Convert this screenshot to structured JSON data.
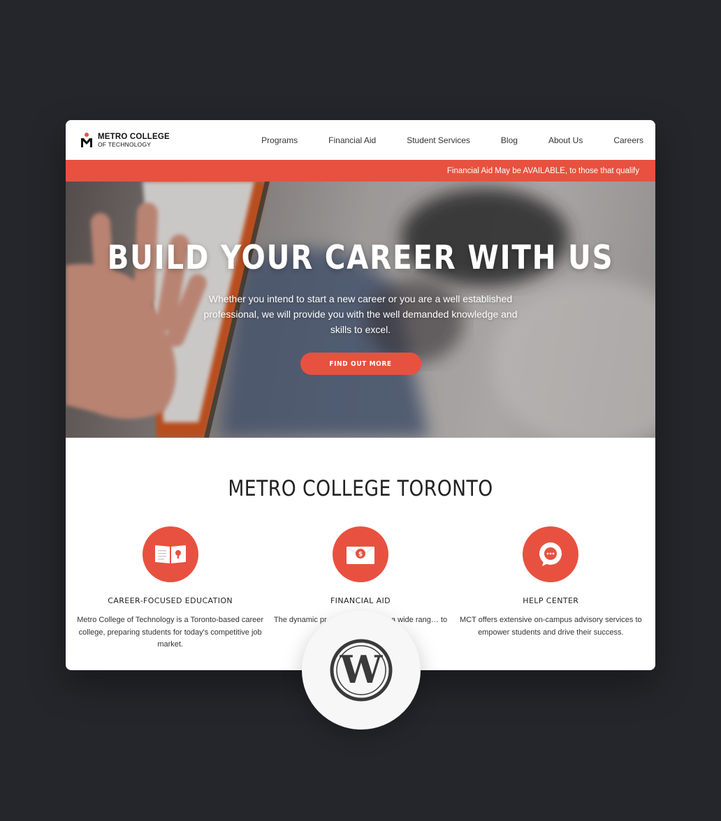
{
  "brand": {
    "line1": "METRO COLLEGE",
    "line2": "OF TECHNOLOGY",
    "logo_icon": "metro-person-icon",
    "accent": "#e8513f",
    "dark_bg": "#24262b"
  },
  "nav": {
    "items": [
      {
        "label": "Programs"
      },
      {
        "label": "Financial Aid"
      },
      {
        "label": "Student Services"
      },
      {
        "label": "Blog"
      },
      {
        "label": "About Us"
      },
      {
        "label": "Careers"
      }
    ]
  },
  "announcement": {
    "text": "Financial Aid May be AVAILABLE, to those that qualify"
  },
  "hero": {
    "title": "BUILD YOUR CAREER WITH US",
    "subtitle": "Whether you intend to start a new career or you are a well established professional, we will provide you with the well demanded knowledge and skills to excel.",
    "button_label": "FIND OUT MORE"
  },
  "section": {
    "title": "METRO COLLEGE TORONTO"
  },
  "features": [
    {
      "icon": "book-icon",
      "title": "CAREER-FOCUSED EDUCATION",
      "description": "Metro College of Technology is a Toronto-based career college, preparing students for today's competitive job market."
    },
    {
      "icon": "money-envelope-icon",
      "title": "FINANCIAL AID",
      "description": "The dynamic pr… vides access to a wide rang… to kick-start"
    },
    {
      "icon": "chat-bubble-icon",
      "title": "HELP CENTER",
      "description": "MCT offers extensive on-campus advisory services to empower students and drive their success."
    }
  ],
  "overlay_badge": {
    "icon": "wordpress-logo-icon"
  }
}
